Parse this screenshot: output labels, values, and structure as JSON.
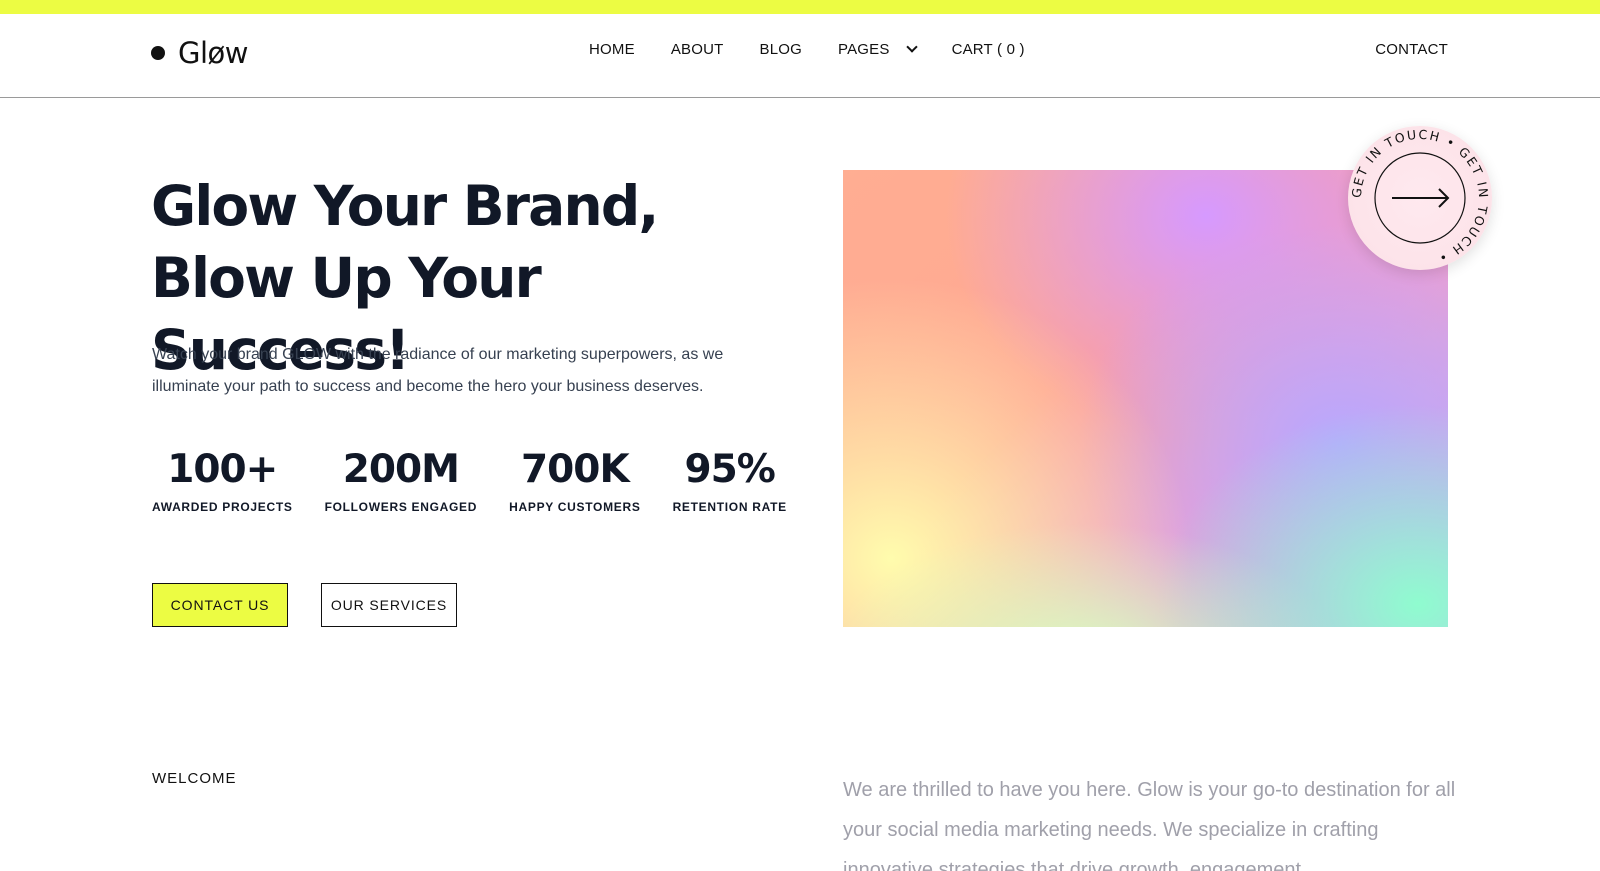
{
  "colors": {
    "accent": "#ecfc43",
    "text": "#111827",
    "muted": "#a0a0aa"
  },
  "header": {
    "logo_text": "Gløw",
    "nav": {
      "home": "HOME",
      "about": "ABOUT",
      "blog": "BLOG",
      "pages": "PAGES",
      "cart": "CART ( 0 )"
    },
    "contact": "CONTACT"
  },
  "hero": {
    "title_part1": "Glow Your ",
    "title_highlight": "Brand,",
    "title_part2": " Blow Up Your Success!",
    "description": "Watch your brand GLOW with the radiance of our marketing superpowers, as we illuminate your path to success and become the hero your business deserves.",
    "stats": [
      {
        "value": "100+",
        "label": "AWARDED PROJECTS"
      },
      {
        "value": "200M",
        "label": "FOLLOWERS ENGAGED"
      },
      {
        "value": "700K",
        "label": "HAPPY CUSTOMERS"
      },
      {
        "value": "95%",
        "label": "RETENTION RATE"
      }
    ],
    "primary_button": "CONTACT US",
    "secondary_button": "OUR SERVICES",
    "badge_text": "GET IN TOUCH • GET IN TOUCH • "
  },
  "welcome": {
    "label": "WELCOME",
    "text": "We are thrilled to have you here. Glow is your go-to destination for all your social media marketing needs. We specialize in crafting innovative strategies that drive growth, engagement"
  }
}
